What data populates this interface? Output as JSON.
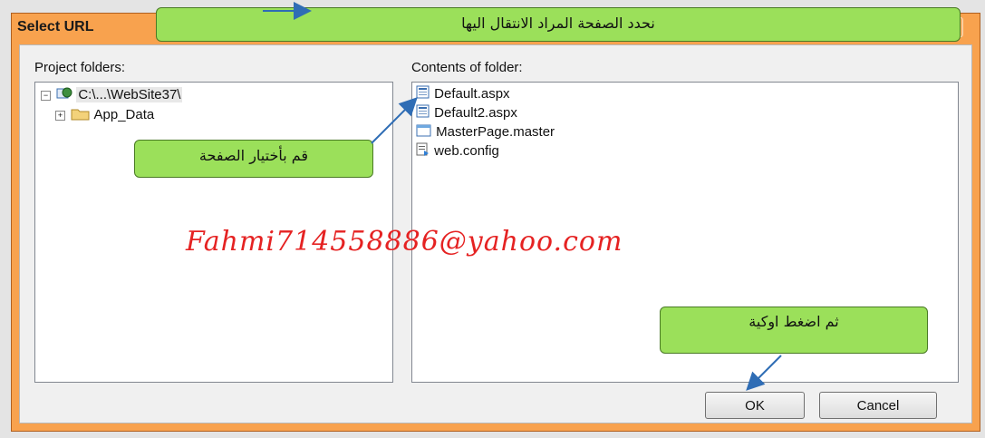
{
  "dialog": {
    "title": "Select URL",
    "project_folders_label": "Project folders:",
    "contents_label": "Contents of folder:",
    "tree": [
      {
        "label": "C:\\...\\WebSite37\\",
        "icon": "website-icon",
        "expander": "minus"
      },
      {
        "label": "App_Data",
        "icon": "folder-icon",
        "expander": "plus"
      }
    ],
    "files": [
      {
        "label": "Default.aspx",
        "icon": "aspx-page-icon"
      },
      {
        "label": "Default2.aspx",
        "icon": "aspx-page-icon"
      },
      {
        "label": "MasterPage.master",
        "icon": "master-page-icon"
      },
      {
        "label": "web.config",
        "icon": "config-file-icon"
      }
    ],
    "ok_label": "OK",
    "cancel_label": "Cancel"
  },
  "annotations": {
    "top_callout": "نحدد الصفحة المراد الانتقال اليها",
    "select_page_callout": "قم بأختيار الصفحة",
    "press_ok_callout": "ثم اضغط اوكية",
    "watermark": "Fahmi714558886@yahoo.com"
  },
  "colors": {
    "title_bar": "#f8a24e",
    "callout_green": "#9be05a",
    "watermark_red": "#e52222",
    "arrow_blue": "#2f6db5"
  }
}
